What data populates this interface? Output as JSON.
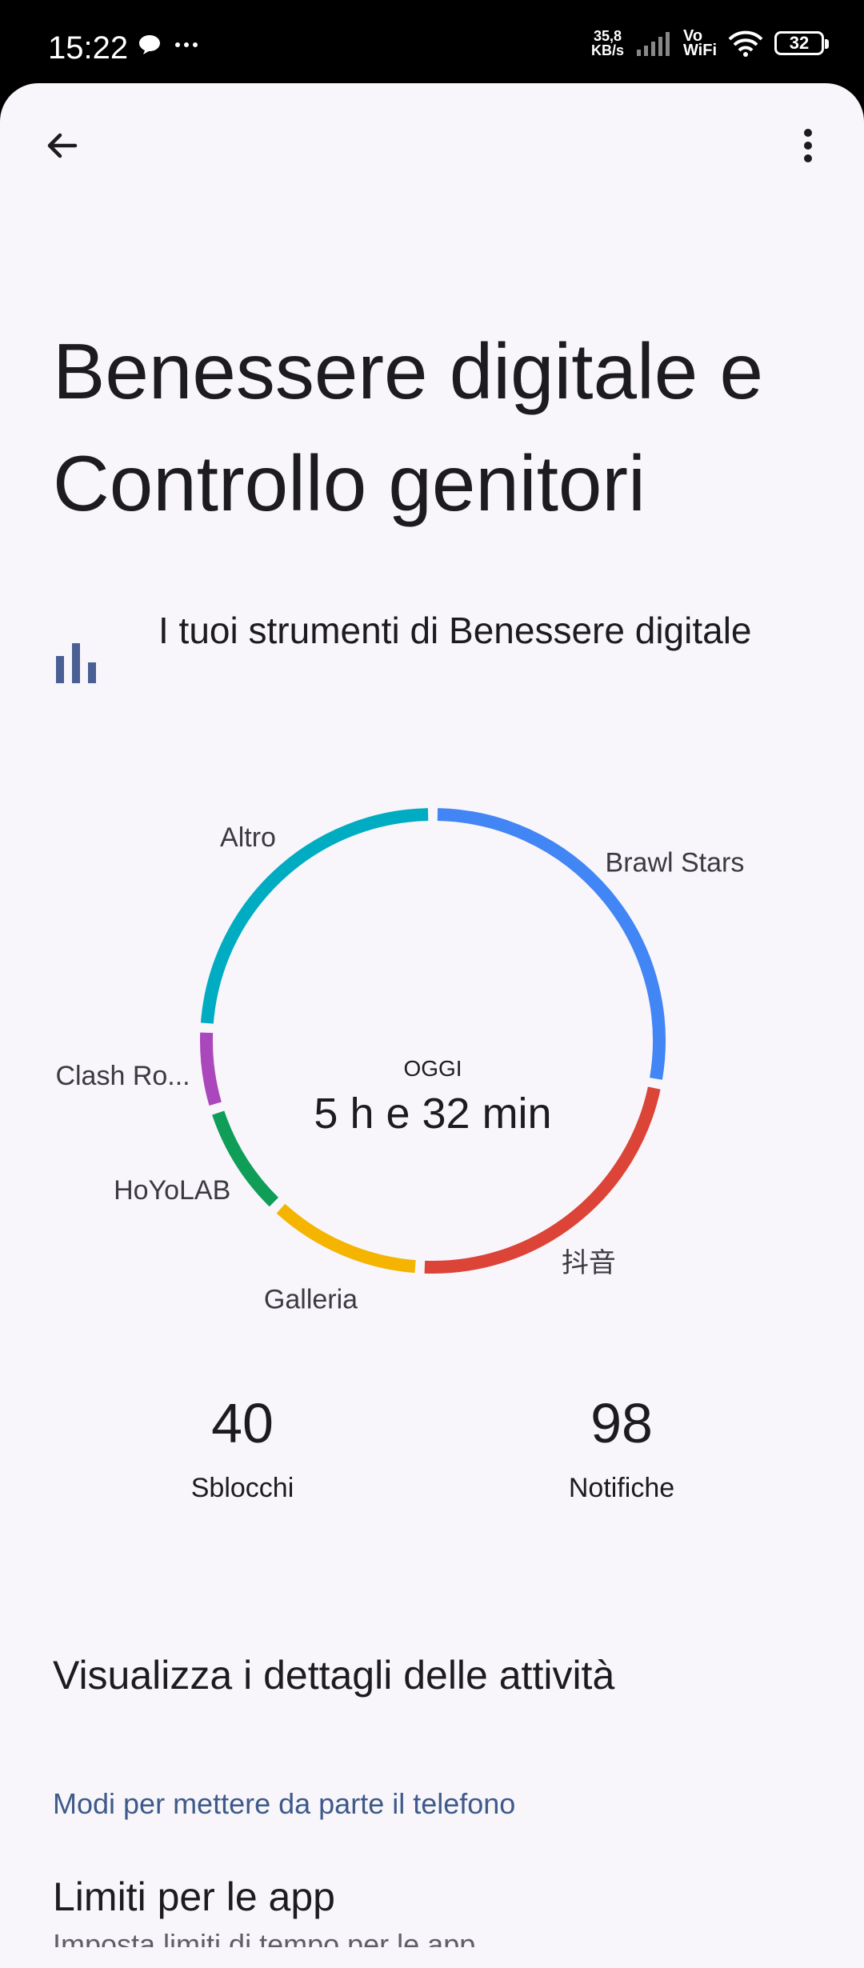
{
  "status_bar": {
    "time": "15:22",
    "speed_value": "35,8",
    "speed_unit": "KB/s",
    "vo": "Vo",
    "wifi": "WiFi",
    "battery": "32"
  },
  "top_bar": {
    "back_icon": "arrow-back-icon",
    "menu_icon": "more-vert-icon"
  },
  "header": {
    "title_line1": "Benessere digitale e",
    "title_line2": "Controllo genitori"
  },
  "tools": {
    "icon": "bar-chart-icon",
    "icon_color": "#4a5f94",
    "label": "I tuoi strumenti di Benessere digitale"
  },
  "chart_data": {
    "type": "pie",
    "center_caption": "OGGI",
    "center_value": "5 h e 32 min",
    "categories": [
      "Brawl Stars",
      "抖音",
      "Galleria",
      "HoYoLAB",
      "Clash Ro...",
      "Altro"
    ],
    "values": [
      93,
      76,
      37,
      27,
      19,
      80
    ],
    "colors": [
      "#4285f4",
      "#db4437",
      "#f4b400",
      "#0f9d58",
      "#ab47bc",
      "#00acc1"
    ]
  },
  "stats": {
    "unlocks_value": "40",
    "unlocks_label": "Sblocchi",
    "notifications_value": "98",
    "notifications_label": "Notifiche"
  },
  "activity_link": "Visualizza i dettagli delle attività",
  "section_header": "Modi per mettere da parte il telefono",
  "app_limits": {
    "title": "Limiti per le app",
    "subtitle": "Imposta limiti di tempo per le app"
  },
  "nav_bar": {
    "recents_icon": "square-icon",
    "home_icon": "circle-home-icon",
    "back_icon": "triangle-back-icon"
  }
}
